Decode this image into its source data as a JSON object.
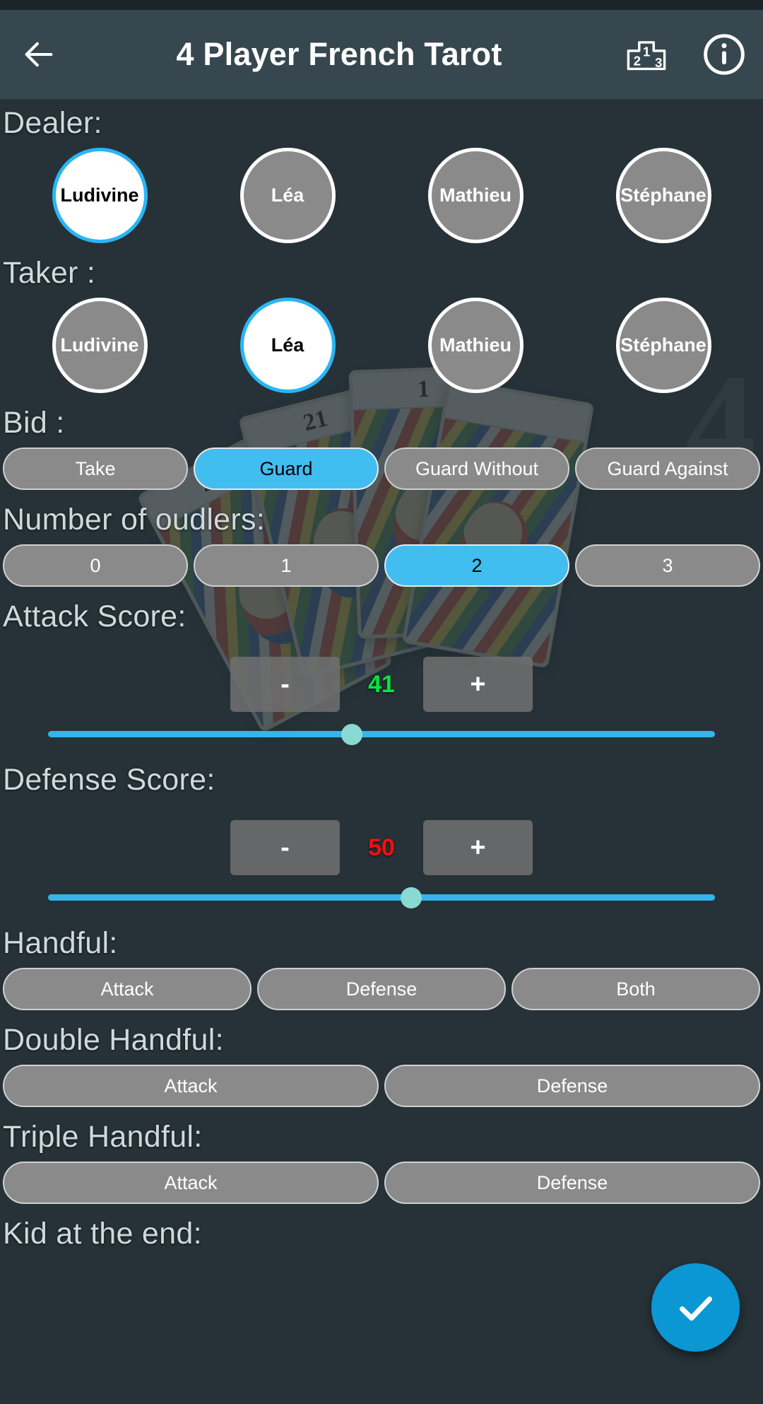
{
  "app": {
    "title": "4 Player French Tarot",
    "back_icon": "arrow-left-icon",
    "leaderboard_icon": "podium-213-icon",
    "info_icon": "info-circle-icon",
    "fab_icon": "check-icon",
    "accent_blue": "#29b6f6",
    "selected_blue": "#41bdf0",
    "fab_blue": "#0b97d4",
    "appbar_bg": "#37474f",
    "page_bg": "#263238",
    "chip_gray": "#8a8a8a",
    "attack_value_color": "#00e83c",
    "defense_value_color": "#ff0c0c"
  },
  "dealer": {
    "label": "Dealer:",
    "players": [
      {
        "name": "Ludivine",
        "selected": true
      },
      {
        "name": "Léa",
        "selected": false
      },
      {
        "name": "Mathieu",
        "selected": false
      },
      {
        "name": "Stéphane",
        "selected": false
      }
    ]
  },
  "taker": {
    "label": "Taker :",
    "players": [
      {
        "name": "Ludivine",
        "selected": false
      },
      {
        "name": "Léa",
        "selected": true
      },
      {
        "name": "Mathieu",
        "selected": false
      },
      {
        "name": "Stéphane",
        "selected": false
      }
    ]
  },
  "bid": {
    "label": "Bid :",
    "options": [
      {
        "label": "Take",
        "selected": false
      },
      {
        "label": "Guard",
        "selected": true
      },
      {
        "label": "Guard Without",
        "selected": false
      },
      {
        "label": "Guard Against",
        "selected": false
      }
    ]
  },
  "oudlers": {
    "label": "Number of oudlers:",
    "options": [
      {
        "label": "0",
        "selected": false
      },
      {
        "label": "1",
        "selected": false
      },
      {
        "label": "2",
        "selected": true
      },
      {
        "label": "3",
        "selected": false
      }
    ]
  },
  "attack_score": {
    "label": "Attack Score:",
    "minus_label": "-",
    "plus_label": "+",
    "value": "41",
    "slider_percent": 45.6
  },
  "defense_score": {
    "label": "Defense Score:",
    "minus_label": "-",
    "plus_label": "+",
    "value": "50",
    "slider_percent": 54.4
  },
  "handful": {
    "label": "Handful:",
    "options": [
      {
        "label": "Attack",
        "selected": false
      },
      {
        "label": "Defense",
        "selected": false
      },
      {
        "label": "Both",
        "selected": false
      }
    ]
  },
  "double_handful": {
    "label": "Double Handful:",
    "options": [
      {
        "label": "Attack",
        "selected": false
      },
      {
        "label": "Defense",
        "selected": false
      }
    ]
  },
  "triple_handful": {
    "label": "Triple Handful:",
    "options": [
      {
        "label": "Attack",
        "selected": false
      },
      {
        "label": "Defense",
        "selected": false
      }
    ]
  },
  "kid_at_end": {
    "label": "Kid at the end:"
  },
  "background_art": {
    "cards": [
      {
        "rank": "21"
      },
      {
        "rank": "21"
      },
      {
        "rank": "1"
      },
      {
        "rank": ""
      }
    ],
    "watermark": "4"
  }
}
